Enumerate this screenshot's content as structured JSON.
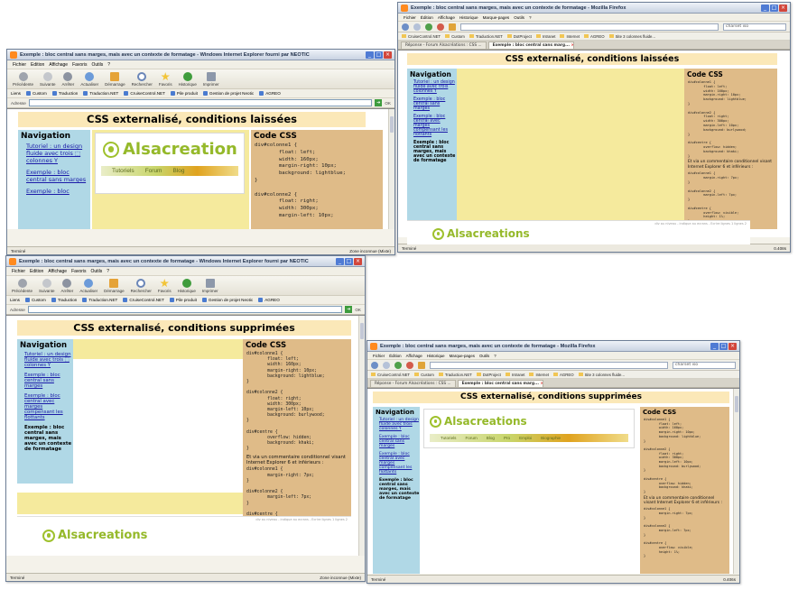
{
  "windows": {
    "ie_top": {
      "title": "Exemple : bloc central sans marges, mais avec un contexte de formatage - Windows Internet Explorer fourni par NEOTIC",
      "menu": [
        "Fichier",
        "Edition",
        "Affichage",
        "Favoris",
        "Outils",
        "?"
      ],
      "toolbar": [
        "Précédente",
        "Suivante",
        "Arrêter",
        "Actualiser",
        "Démarrage",
        "Rechercher",
        "Favoris",
        "Historique",
        "Imprimer"
      ],
      "links_label": "Liens",
      "links": [
        "Custom",
        "Traduction",
        "Traduction.NET",
        "CruiseControl.NET",
        "Pile produit",
        "Gestion de projet Neotic",
        "AGREO"
      ],
      "address_label": "Adresse",
      "go_label": "OK",
      "status_left": "Terminé",
      "status_right": "Zone inconnue (Mixte)",
      "page": {
        "heading": "CSS externalisé, conditions laissées",
        "nav_title": "Navigation",
        "nav_items": [
          "Tutoriel : un design fluide avec trois ⬚ colonnes Y",
          "Exemple : bloc central sans marges",
          "Exemple : bloc"
        ],
        "logo": "Alsacreation",
        "banner_tabs": [
          "Tutoriels",
          "Forum",
          "Blog"
        ],
        "code_title": "Code CSS",
        "code": "div#colonne1 {\n        float: left;\n        width: 160px;\n        margin-right: 10px;\n        background: lightblue;\n}\n\ndiv#colonne2 {\n        float: right;\n        width: 300px;\n        margin-left: 10px;"
      }
    },
    "ff_top": {
      "title": "Exemple : bloc central sans marges, mais avec un contexte de formatage - Mozilla Firefox",
      "menu": [
        "Fichier",
        "Édition",
        "Affichage",
        "Historique",
        "Marque-pages",
        "Outils",
        "?"
      ],
      "url": "",
      "search": "charset iso",
      "bookmarks": [
        "CruiseControl.NET",
        "Custom",
        "Traduction.NET",
        "DotProject",
        "Intranet",
        "Internet",
        "AGREO",
        "Site 3 colonnes fluide..."
      ],
      "tabs": [
        "Réponse - Forum Alsacréations : CSS ...",
        "Exemple : bloc central sans marg..."
      ],
      "status_left": "Terminé",
      "status_right": "0.408s",
      "page": {
        "heading": "CSS externalisé, conditions laissées",
        "nav_title": "Navigation",
        "nav_items": [
          "Tutoriel : un design fluide avec trois colonnes Y",
          "Exemple : bloc central sans marges",
          "Exemple : bloc central avec marges compensant les flottants"
        ],
        "nav_current": "Exemple : bloc central sans marges, mais avec un contexte de formatage",
        "code_title": "Code CSS",
        "code": "div#colonne1 {\n        float: left;\n        width: 160px;\n        margin-right: 10px;\n        background: lightblue;\n}\n\ndiv#colonne2 {\n        float: right;\n        width: 300px;\n        margin-left: 10px;\n        background: burlywood;\n}\n\ndiv#centre {\n        overflow: hidden;\n        background: khaki;\n}",
        "code_note": "Et via un commentaire conditionnel visant Internet Explorer 6 et inférieurs :",
        "code2": "div#colonne1 {\n        margin-right: 7px;\n}\n\ndiv#colonne2 {\n        margin-left: 7px;\n}\n\ndiv#centre {\n        overflow: visible;\n        height: 1%;\n}",
        "logo": "Alsacreations",
        "footer_note": "div au niveau - indique au ecrans - Ecrire lignes 1 lignes 2"
      }
    },
    "ie_bottom": {
      "title": "Exemple : bloc central sans marges, mais avec un contexte de formatage - Windows Internet Explorer fourni par NEOTIC",
      "menu": [
        "Fichier",
        "Edition",
        "Affichage",
        "Favoris",
        "Outils",
        "?"
      ],
      "toolbar": [
        "Précédente",
        "Suivante",
        "Arrêter",
        "Actualiser",
        "Démarrage",
        "Rechercher",
        "Favoris",
        "Historique",
        "Imprimer"
      ],
      "links_label": "Liens",
      "links": [
        "Custom",
        "Traduction",
        "Traduction.NET",
        "CruiseControl.NET",
        "Pile produit",
        "Gestion de projet Neotic",
        "AGREO"
      ],
      "address_label": "Adresse",
      "go_label": "OK",
      "status_left": "Terminé",
      "status_right": "Zone inconnue (Mixte)",
      "page": {
        "heading": "CSS externalisé, conditions supprimées",
        "nav_title": "Navigation",
        "nav_items": [
          "Tutoriel : un design fluide avec trois ⬚ colonnes Y",
          "Exemple : bloc central sans marges",
          "Exemple : bloc central avec marges compensant les flottants"
        ],
        "nav_current": "Exemple : bloc central sans marges, mais avec un contexte de formatage",
        "code_title": "Code CSS",
        "code": "div#colonne1 {\n        float: left;\n        width: 160px;\n        margin-right: 10px;\n        background: lightblue;\n}\n\ndiv#colonne2 {\n        float: right;\n        width: 300px;\n        margin-left: 10px;\n        background: burlywood;\n}\n\ndiv#centre {\n        overflow: hidden;\n        background: khaki;\n}",
        "code_note": "Et via un commentaire conditionnel visant Internet Explorer 6 et inférieurs :",
        "code2": "div#colonne1 {\n        margin-right: 7px;\n}\n\ndiv#colonne2 {\n        margin-left: 7px;\n}\n\ndiv#centre {\n        overflow: visible;\n        height: 1%;\n}",
        "logo": "Alsacreations",
        "footer_note": "div au niveau - indique au ecrans - Ecrire lignes 1 lignes 2"
      }
    },
    "ff_bottom": {
      "title": "Exemple : bloc central sans marges, mais avec un contexte de formatage - Mozilla Firefox",
      "menu": [
        "Fichier",
        "Édition",
        "Affichage",
        "Historique",
        "Marque-pages",
        "Outils",
        "?"
      ],
      "url": "",
      "search": "charset iso",
      "bookmarks": [
        "CruiseControl.NET",
        "Custom",
        "Traduction.NET",
        "DotProject",
        "Intranet",
        "Internet",
        "AGREO",
        "Site 3 colonnes fluide..."
      ],
      "tabs": [
        "Réponse - Forum Alsacréations : CSS ...",
        "Exemple : bloc central sans marg..."
      ],
      "status_left": "Terminé",
      "status_right": "0.406s",
      "page": {
        "heading": "CSS externalisé, conditions supprimées",
        "nav_title": "Navigation",
        "nav_items": [
          "Tutoriel : un design fluide avec trois colonnes Y",
          "Exemple : bloc central sans marges",
          "Exemple : bloc central avec marges compensant les flottants"
        ],
        "nav_current": "Exemple : bloc central sans marges, mais avec un contexte de formatage",
        "logo": "Alsacreations",
        "banner_tabs": [
          "Tutoriels",
          "Forum",
          "Blog",
          "Pro",
          "Emploi",
          "Biographie"
        ],
        "code_title": "Code CSS",
        "code": "div#colonne1 {\n        float: left;\n        width: 160px;\n        margin-right: 10px;\n        background: lightblue;\n}\n\ndiv#colonne2 {\n        float: right;\n        width: 300px;\n        margin-left: 10px;\n        background: burlywood;\n}\n\ndiv#centre {\n        overflow: hidden;\n        background: khaki;\n}",
        "code_note": "Et via un commentaire conditionnel visant Internet Explorer 6 et inférieurs :",
        "code2": "div#colonne1 {\n        margin-right: 7px;\n}\n\ndiv#colonne2 {\n        margin-left: 7px;\n}\n\ndiv#centre {\n        overflow: visible;\n        height: 1%;\n}"
      }
    }
  },
  "colors": {
    "nav_column": "#b0d8e6",
    "center_column": "#f5ea9d",
    "code_column": "#dfbb88",
    "heading_bar": "#fbe8b8",
    "logo_green": "#95b92a"
  }
}
